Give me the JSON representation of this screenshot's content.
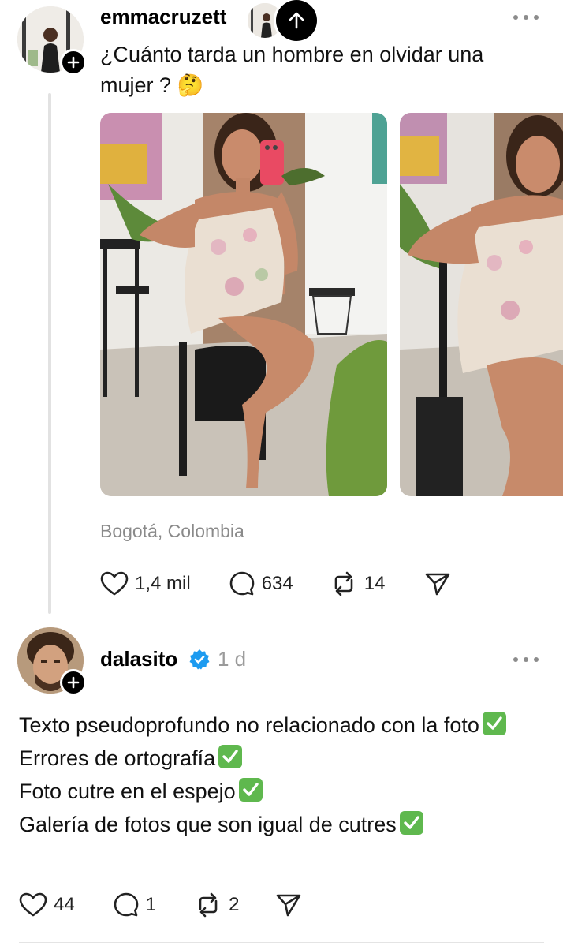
{
  "post1": {
    "username": "emmacruzett",
    "text": "¿Cuánto tarda un hombre en olvidar una mujer ? 🤔",
    "location": "Bogotá, Colombia",
    "actions": {
      "likes": "1,4 mil",
      "comments": "634",
      "reposts": "14"
    }
  },
  "post2": {
    "username": "dalasito",
    "time": "1 d",
    "lines": [
      "Texto pseudoprofundo no relacionado con la foto",
      "Errores de ortografía",
      "Foto cutre en el espejo",
      "Galería de fotos que son igual de cutres"
    ],
    "actions": {
      "likes": "44",
      "comments": "1",
      "reposts": "2"
    }
  },
  "icons": {
    "like": "heart-icon",
    "comment": "comment-bubble-icon",
    "repost": "repost-icon",
    "share": "send-icon",
    "more": "more-dots-icon",
    "verified": "verified-badge-icon",
    "follow": "plus-icon",
    "check": "check-mark-emoji"
  },
  "colors": {
    "verified": "#1d9bf0",
    "check": "#5fb84e",
    "muted": "#8a8a8a"
  }
}
